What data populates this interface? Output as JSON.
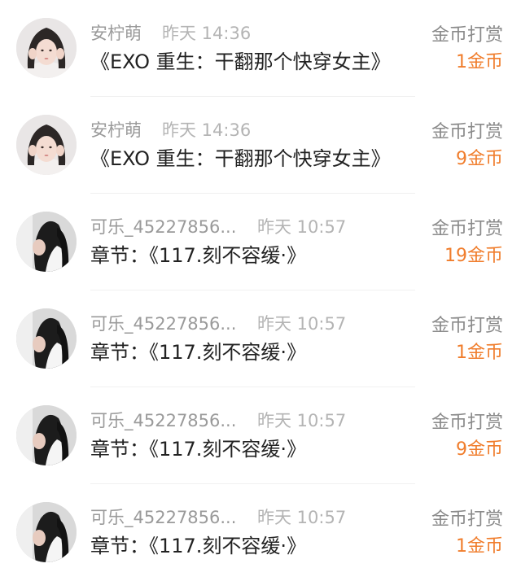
{
  "colors": {
    "accent_orange": "#f07d2c",
    "username_gray": "#9a9a9a",
    "time_gray": "#b4b4b4",
    "text_dark": "#222222",
    "divider": "#f0f0f0"
  },
  "rows": [
    {
      "avatar_icon": "user-avatar-photo-girl",
      "username": "安柠萌",
      "time": "昨天 14:36",
      "content": "《EXO 重生：干翻那个快穿女主》",
      "reward_label": "金币打赏",
      "reward_amount": "1金币"
    },
    {
      "avatar_icon": "user-avatar-photo-girl",
      "username": "安柠萌",
      "time": "昨天 14:36",
      "content": "《EXO 重生：干翻那个快穿女主》",
      "reward_label": "金币打赏",
      "reward_amount": "9金币"
    },
    {
      "avatar_icon": "user-avatar-photo-dark",
      "username": "可乐_45227856...",
      "time": "昨天 10:57",
      "content": "章节：《117.刻不容缓·》",
      "reward_label": "金币打赏",
      "reward_amount": "19金币"
    },
    {
      "avatar_icon": "user-avatar-photo-dark",
      "username": "可乐_45227856...",
      "time": "昨天 10:57",
      "content": "章节：《117.刻不容缓·》",
      "reward_label": "金币打赏",
      "reward_amount": "1金币"
    },
    {
      "avatar_icon": "user-avatar-photo-dark",
      "username": "可乐_45227856...",
      "time": "昨天 10:57",
      "content": "章节：《117.刻不容缓·》",
      "reward_label": "金币打赏",
      "reward_amount": "9金币"
    },
    {
      "avatar_icon": "user-avatar-photo-dark",
      "username": "可乐_45227856...",
      "time": "昨天 10:57",
      "content": "章节：《117.刻不容缓·》",
      "reward_label": "金币打赏",
      "reward_amount": "1金币"
    }
  ]
}
